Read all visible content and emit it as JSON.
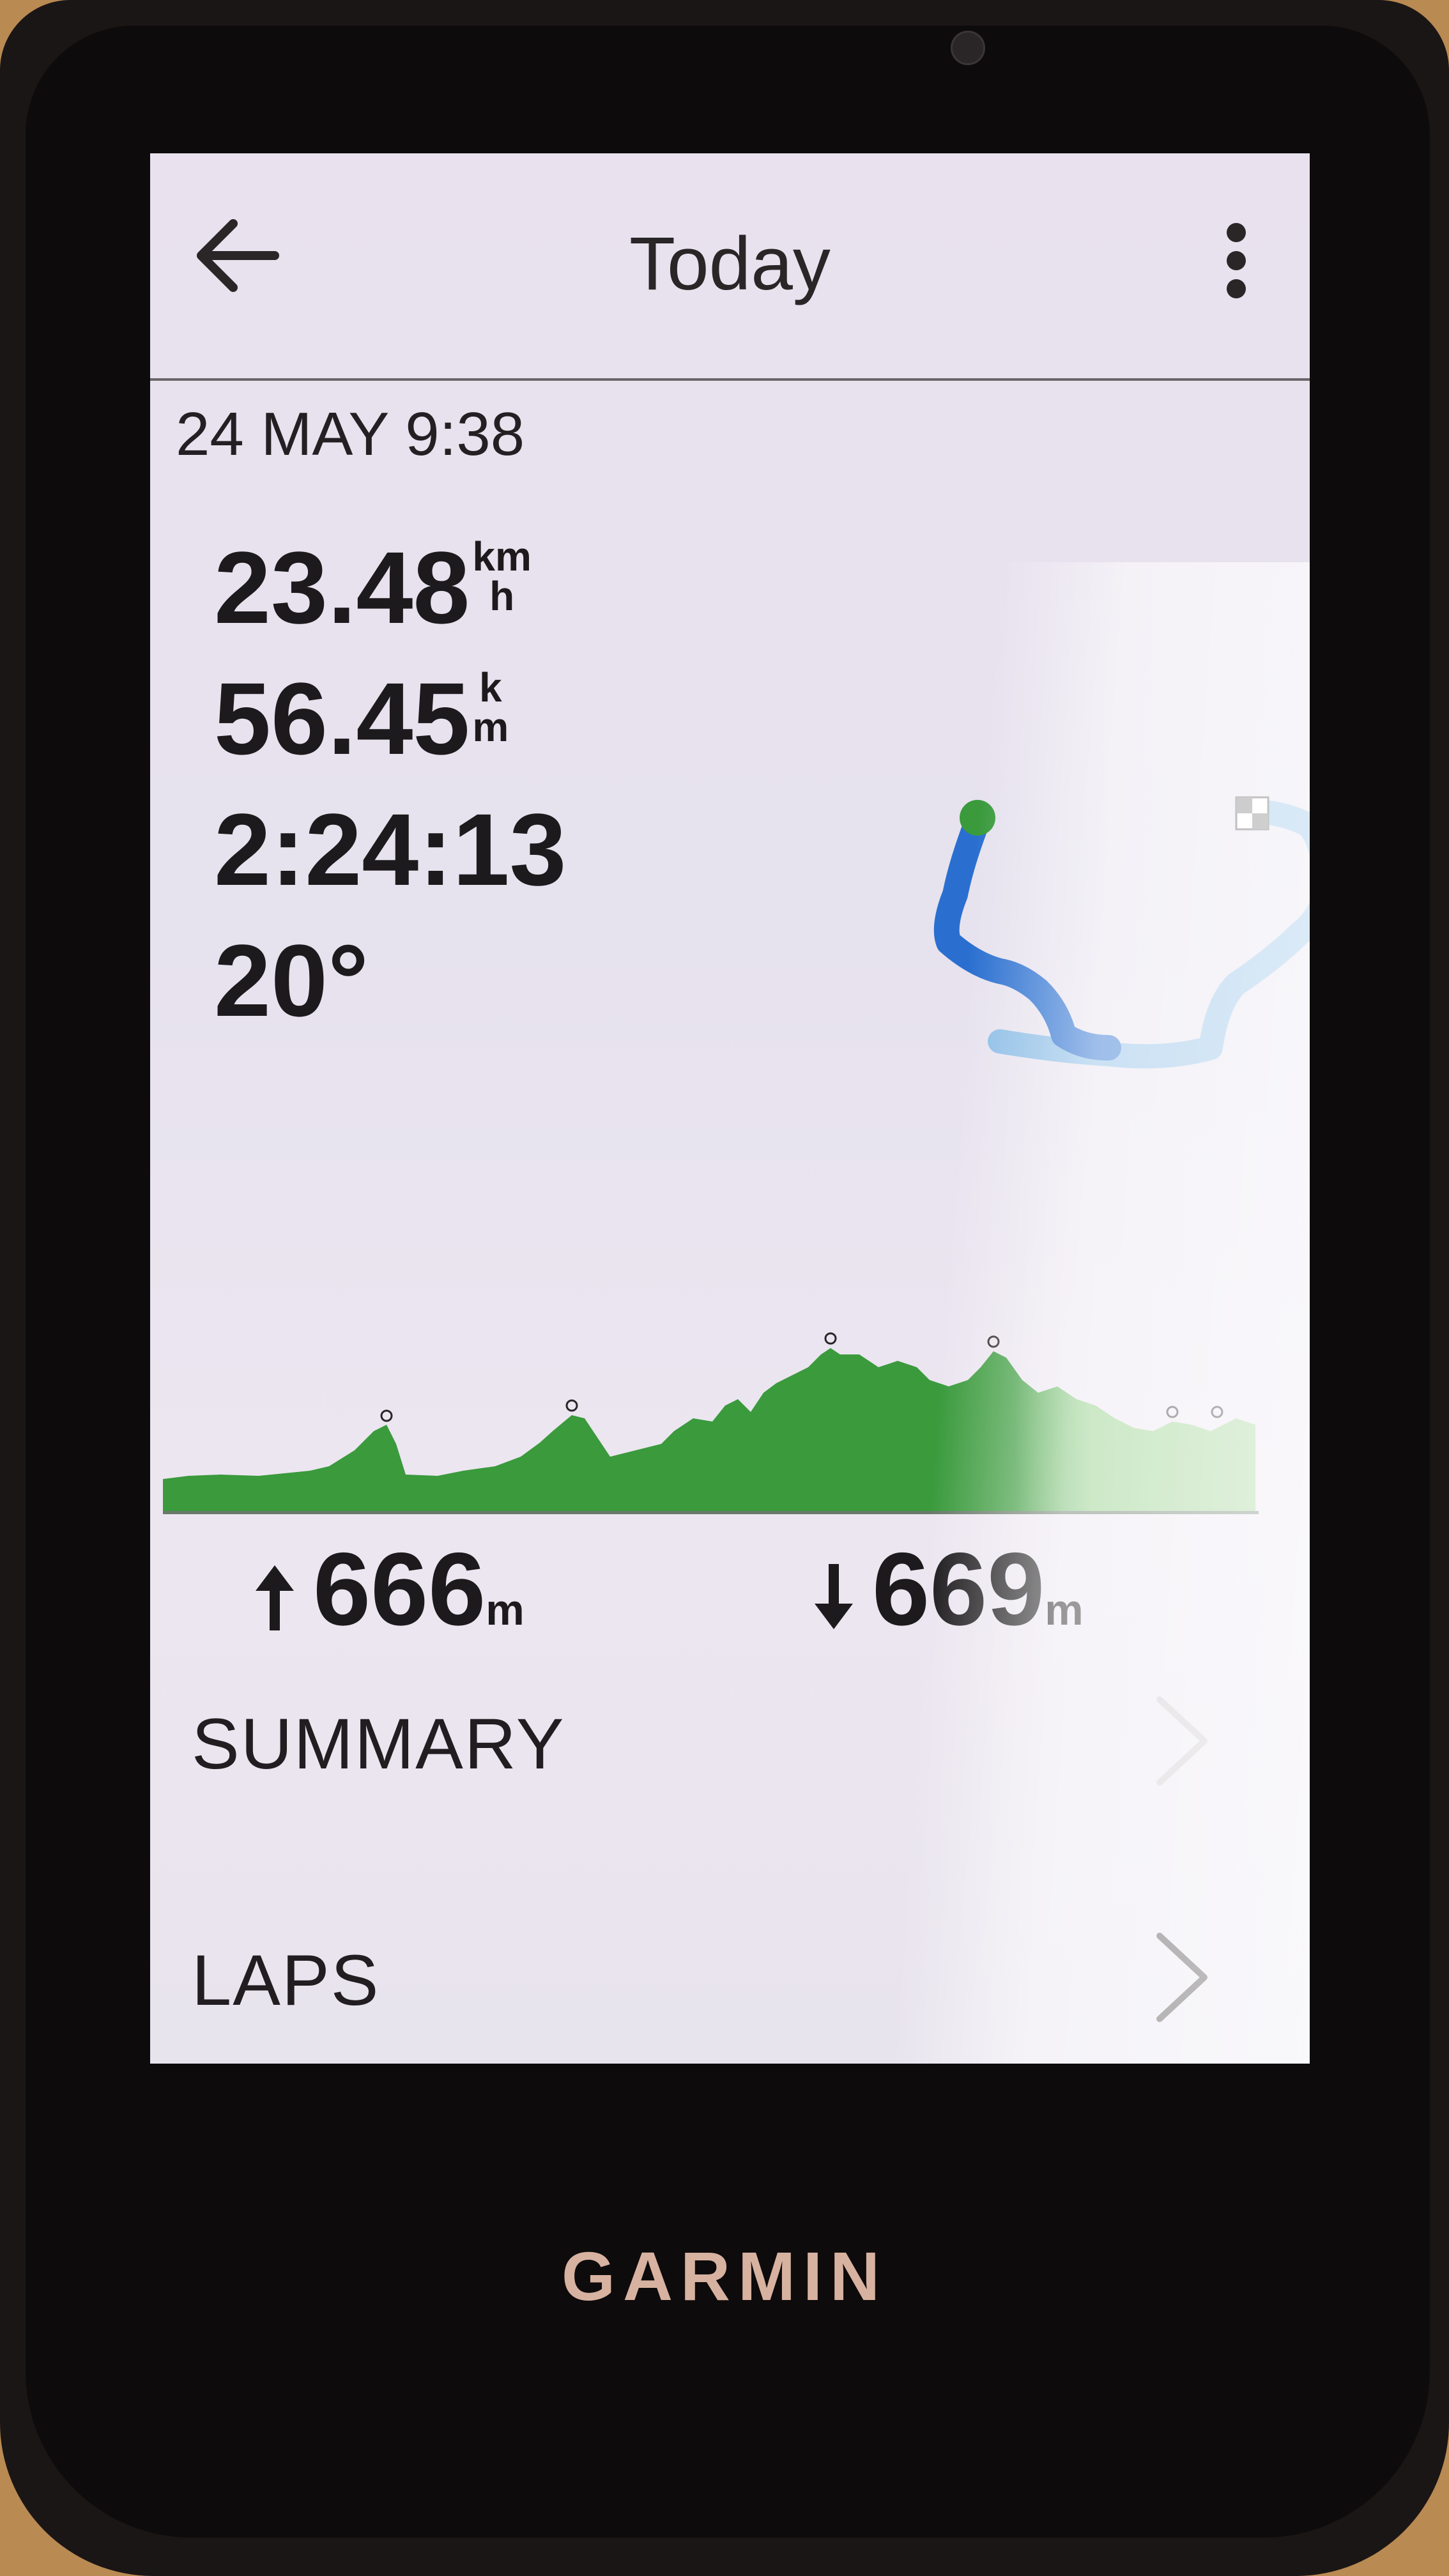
{
  "header": {
    "title": "Today",
    "back_icon": "arrow-left-icon",
    "menu_icon": "vertical-dots-icon"
  },
  "activity": {
    "timestamp": "24 MAY 9:38",
    "avg_speed": {
      "value": "23.48",
      "unit_top": "km",
      "unit_bottom": "h"
    },
    "distance": {
      "value": "56.45",
      "unit_top": "k",
      "unit_bottom": "m"
    },
    "time": "2:24:13",
    "temperature": "20°"
  },
  "elevation": {
    "ascent": {
      "value": "666",
      "unit": "m"
    },
    "descent": {
      "value": "669",
      "unit": "m"
    }
  },
  "menu": [
    {
      "label": "SUMMARY"
    },
    {
      "label": "LAPS"
    }
  ],
  "device": {
    "brand": "GARMIN"
  },
  "colors": {
    "route_dark": "#2a6fd0",
    "route_light": "#8cbde6",
    "elev_fill": "#3a9a3c",
    "elev_fill_light": "#8ccc80",
    "brand": "#d8b2a0"
  }
}
